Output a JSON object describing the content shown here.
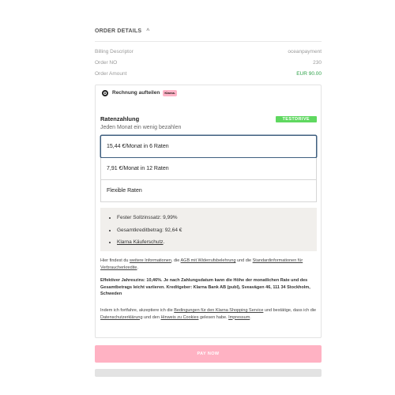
{
  "order": {
    "heading": "ORDER DETAILS",
    "chevron": "^",
    "rows": [
      {
        "label": "Billing Descriptor",
        "value": "oceanpayment"
      },
      {
        "label": "Order NO",
        "value": "230"
      },
      {
        "label": "Order Amount",
        "value": "EUR 90.00"
      }
    ]
  },
  "klarna": {
    "radio_label": "Rechnung aufteilen",
    "badge": "Klarna.",
    "ratenzahlung_title": "Ratenzahlung",
    "testdrive_badge": "TESTDRIVE",
    "subtitle": "Jeden Monat ein wenig bezahlen",
    "options": [
      "15,44 €/Monat in 6 Raten",
      "7,91 €/Monat in 12 Raten",
      "Flexible Raten"
    ],
    "info": {
      "item1": "Fester Sollzinssatz: 9,99%",
      "item2": "Gesamtkreditbetrag: 92,64 €",
      "item3_link": "Klarna Käuferschutz",
      "item3_suffix": "."
    },
    "legal1": {
      "t1": "Hier findest du ",
      "link1": "weitere Informationen",
      "t2": ", die ",
      "link2": "AGB mit Widerrufsbelehrung",
      "t3": " und die ",
      "link3": "Standardinformationen für Verbraucherkredite",
      "t4": "."
    },
    "legal2": "Effektiver Jahreszins: 10,46%. Je nach Zahlungsdatum kann die Höhe der monatlichen Rate und des Gesamtbetrags leicht variieren. Kreditgeber: Klarna Bank AB (publ), Sveavägen 46, 111 34 Stockholm, Schweden",
    "legal3": {
      "t1": "Indem ich fortfahre, akzeptiere ich die ",
      "link1": "Bedingungen für den Klarna Shopping Service",
      "t2": " und bestätige, dass ich die ",
      "link2": "Datenschutzerklärung",
      "t3": " und den ",
      "link3": "Hinweis zu Cookies",
      "t4": " gelesen habe. ",
      "link4": "Impressum",
      "t5": "."
    }
  },
  "pay_button": "PAY NOW",
  "colors": {
    "accent_green": "#5fd860",
    "amount_green": "#2fa24a",
    "klarna_pink": "#ffb3c7",
    "pay_pink": "#ffb2c3",
    "selected_border": "#3f5f7f"
  }
}
